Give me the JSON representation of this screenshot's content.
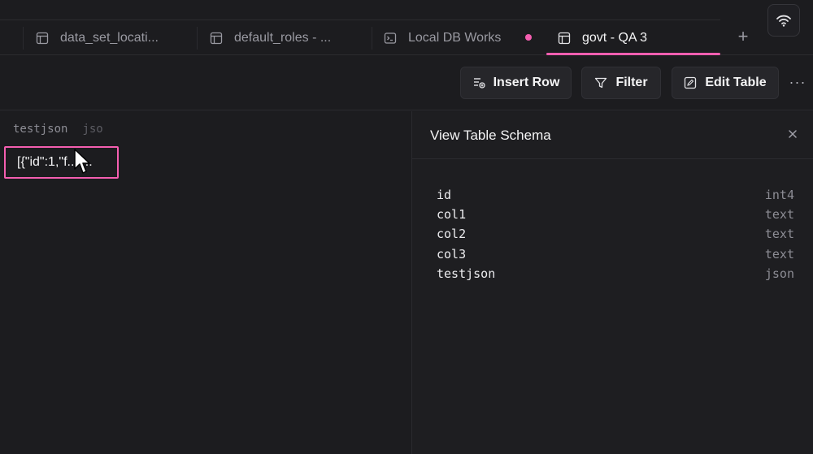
{
  "tabs": [
    {
      "label": "data_set_locati...",
      "icon": "table-icon",
      "active": false
    },
    {
      "label": "default_roles - ...",
      "icon": "table-icon",
      "active": false
    },
    {
      "label": "Local DB Works",
      "icon": "terminal-icon",
      "active": false,
      "unsaved": true
    },
    {
      "label": "govt - QA 3",
      "icon": "table-icon",
      "active": true
    }
  ],
  "add_tab_label": "+",
  "toolbar": {
    "insert_row_label": "Insert Row",
    "filter_label": "Filter",
    "edit_table_label": "Edit Table",
    "more_label": "···"
  },
  "grid": {
    "column_name": "testjson",
    "column_type": "jso",
    "cell_value": "[{\"id\":1,\"f...t..."
  },
  "schema_panel": {
    "title": "View Table Schema",
    "close_label": "×",
    "columns": [
      {
        "name": "id",
        "type": "int4"
      },
      {
        "name": "col1",
        "type": "text"
      },
      {
        "name": "col2",
        "type": "text"
      },
      {
        "name": "col3",
        "type": "text"
      },
      {
        "name": "testjson",
        "type": "json"
      }
    ]
  },
  "colors": {
    "background": "#1c1c1f",
    "accent": "#f45eb0",
    "panel": "#1e1e21",
    "border": "#2b2b2f"
  }
}
